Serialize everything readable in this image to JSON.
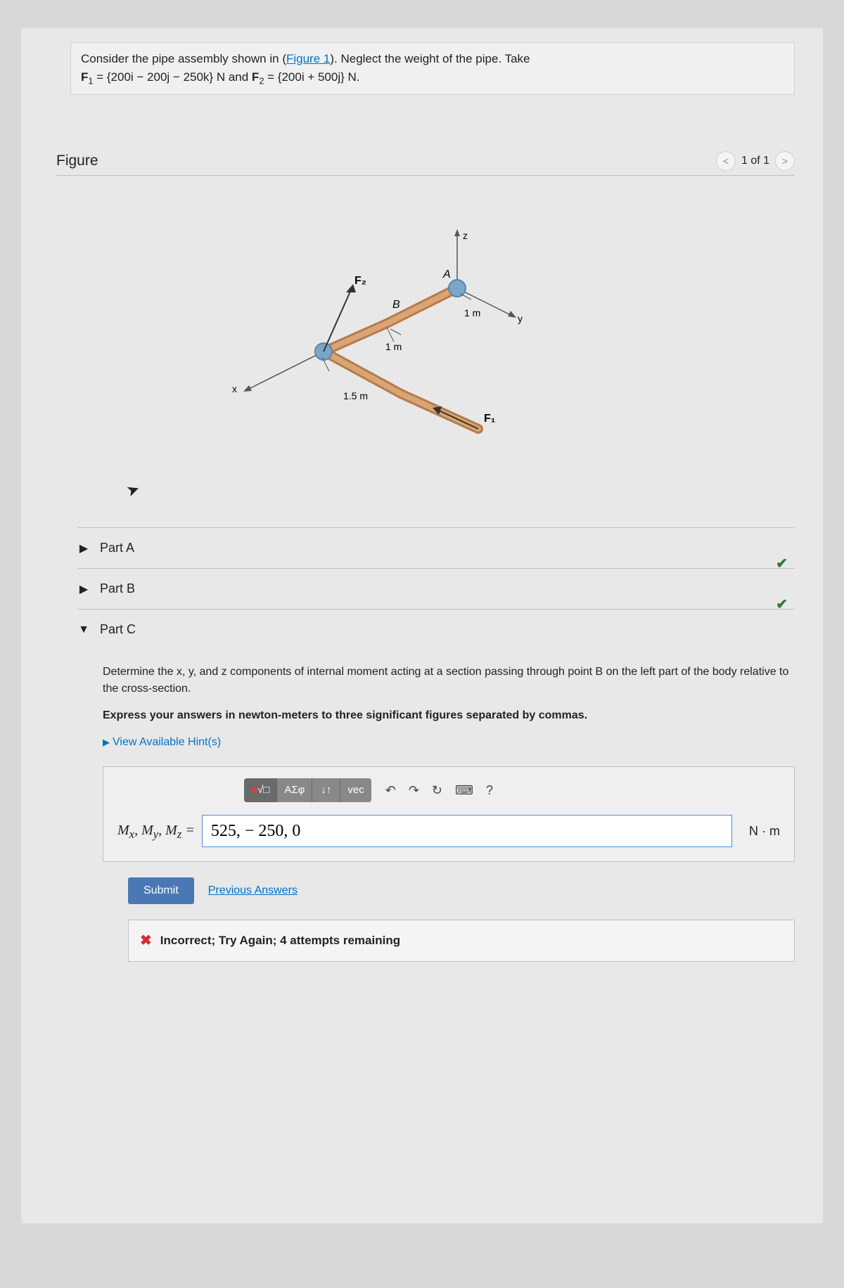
{
  "problem": {
    "intro": "Consider the pipe assembly shown in (",
    "figlink": "Figure 1",
    "after_link": "). Neglect the weight of the pipe. Take",
    "f1_prefix": "F",
    "f1_sub": "1",
    "f1_eq": " = {200i − 200j − 250k} N and ",
    "f2_prefix": "F",
    "f2_sub": "2",
    "f2_eq": " = {200i + 500j} N."
  },
  "figure": {
    "title": "Figure",
    "pager": "1 of 1",
    "labels": {
      "F1": "F₁",
      "F2": "F₂",
      "A": "A",
      "B": "B",
      "x": "x",
      "y": "y",
      "z": "z",
      "d1": "1 m",
      "d2": "1 m",
      "d3": "1.5 m"
    }
  },
  "parts": {
    "a": "Part A",
    "b": "Part B",
    "c": "Part C"
  },
  "partC": {
    "instruction1": "Determine the x, y, and z components of internal moment acting at a section passing through point B on the left part of the body relative to the cross-section.",
    "instruction2": "Express your answers in newton-meters to three significant figures separated by commas.",
    "hints": "View Available Hint(s)",
    "answer_label": "Mₓ, Mᵧ, M_z =",
    "answer_value": "525, − 250, 0",
    "unit": "N · m",
    "toolbar": {
      "sq": "■",
      "root": "√□",
      "greek": "ΑΣφ",
      "arrows": "↓↑",
      "vec": "vec",
      "undo": "↶",
      "redo": "↷",
      "reset": "↻",
      "keyboard": "⌨",
      "help": "?"
    },
    "submit": "Submit",
    "previous": "Previous Answers",
    "feedback": "Incorrect; Try Again; 4 attempts remaining"
  }
}
